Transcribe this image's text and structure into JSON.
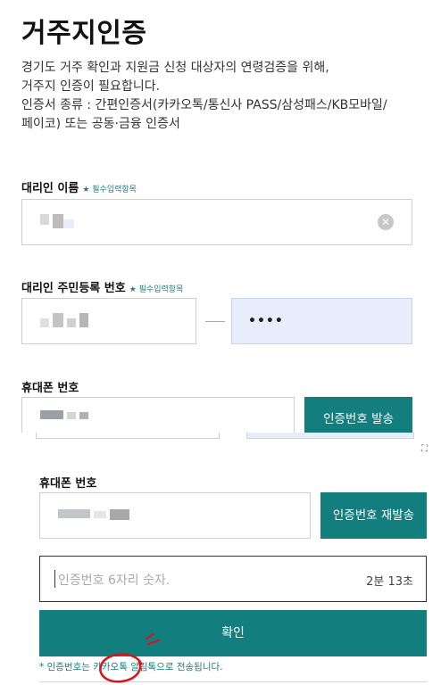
{
  "page": {
    "title": "거주지인증",
    "description": [
      "경기도 거주 확인과 지원금 신청 대상자의 연령검증을 위해,",
      "거주지 인증이 필요합니다.",
      "인증서 종류 : 간편인증서(카카오톡/통신사 PASS/삼성패스/KB모바일/",
      "페이코) 또는 공동·금융 인증서"
    ]
  },
  "form": {
    "name_label": "대리인 이름",
    "required_text": "필수입력항목",
    "rrn_label": "대리인 주민등록 번호",
    "rrn_back_masked": "••••",
    "rrn_separator": "—",
    "phone_label": "휴대폰 번호",
    "send_code_button": "인증번호 발송"
  },
  "overlay": {
    "phone_label": "휴대폰 번호",
    "resend_button": "인증번호 재발송",
    "code_placeholder": "인증번호 6자리 숫자.",
    "timer": "2분 13초",
    "confirm_button": "확인",
    "note": "* 인증번호는 카카오톡 알림톡으로 전송됩니다."
  },
  "icons": {
    "clear": "clear-circle-icon",
    "screenshot_corner": "screenshot-corner-icon"
  },
  "colors": {
    "accent": "#127f7e",
    "annotation": "#d9151b"
  }
}
